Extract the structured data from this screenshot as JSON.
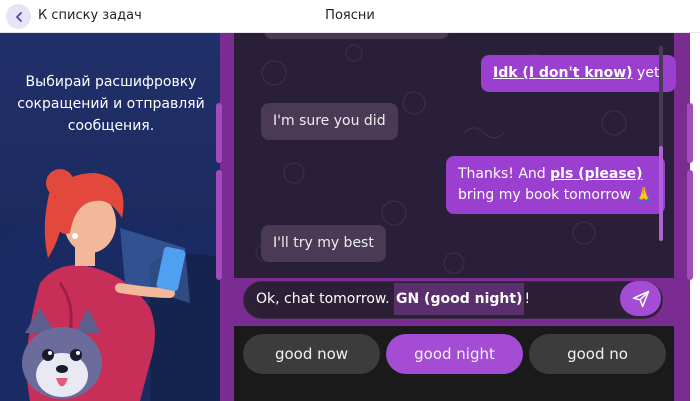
{
  "header": {
    "back_label": "К списку задач",
    "title": "Поясни"
  },
  "left": {
    "instruction": "Выбирай расшифровку сокращений и отправляй сообщения."
  },
  "chat": {
    "messages": [
      {
        "side": "out",
        "highlight": "Idk (I don't know)",
        "rest": " yet."
      },
      {
        "side": "in",
        "text": "I'm sure you did"
      },
      {
        "side": "out",
        "prefix": "Thanks! And ",
        "highlight": "pls (please)",
        "line2": "bring my book tomorrow 🙏"
      },
      {
        "side": "in",
        "text": "I'll try my best"
      }
    ]
  },
  "composer": {
    "prefix": "Ok, chat tomorrow. ",
    "blank": "GN (good night)",
    "suffix": "!"
  },
  "options": [
    {
      "label": "good now",
      "active": false
    },
    {
      "label": "good night",
      "active": true
    },
    {
      "label": "good no",
      "active": false
    }
  ],
  "colors": {
    "accent": "#a44cd4",
    "bubble_out": "#9b3fd0",
    "bubble_in": "#4a3a55",
    "left_bg": "#21306a"
  }
}
